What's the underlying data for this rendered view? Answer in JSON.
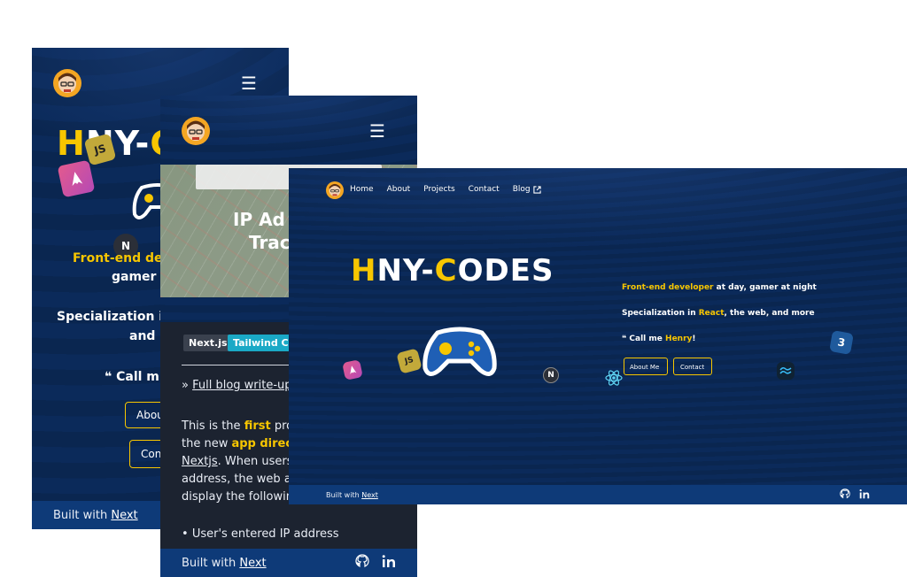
{
  "brand": {
    "name": "HNY-CODES",
    "first": "H",
    "mid": "NY-",
    "c": "C",
    "rest": "ODES"
  },
  "colors": {
    "accent": "#f7c600",
    "navy": "#0b2a5a",
    "footer": "#0e3a78"
  },
  "window1": {
    "menu_icon": "hamburger-icon",
    "hero_visible": "HNY-C",
    "hero_h": "H",
    "hero_ny": "NY-",
    "hero_c": "C",
    "line1_a": "Front-end dev",
    "line2": "gamer a",
    "line3": "Specialization in",
    "line4": "and r",
    "line5": "Call m",
    "about_btn": "Abou",
    "contact_btn": "Con",
    "footer_text": "Built with",
    "footer_link": "Next"
  },
  "window2": {
    "map_title_1": "IP Ad",
    "map_title_2": "Trac",
    "tags": [
      "Next.js",
      "Tailwind CSS"
    ],
    "blog_prefix": "» ",
    "blog_link": "Full blog write-up",
    "para_1": "This is the ",
    "para_first": "first",
    "para_2": " proje",
    "para_3": "the new ",
    "para_appdir": "app directo",
    "para_4": "Nextjs",
    "para_5": ". When users",
    "para_6": "address, the web ap",
    "para_7": "display the following",
    "bullet": "User's entered IP address",
    "footer_text": "Built with",
    "footer_link": "Next"
  },
  "window3": {
    "nav": [
      "Home",
      "About",
      "Projects",
      "Contact",
      "Blog"
    ],
    "hero_h": "H",
    "hero_ny": "NY-",
    "hero_c": "C",
    "hero_rest": "ODES",
    "line1_yellow": "Front-end developer",
    "line1_rest": " at day, gamer at night",
    "line2_a": "Specialization in ",
    "line2_yellow": "React",
    "line2_rest": ", the web, and more",
    "line3_a": "Call me ",
    "line3_yellow": "Henry",
    "line3_rest": "!",
    "about_btn": "About Me",
    "contact_btn": "Contact",
    "footer_text": "Built with",
    "footer_link": "Next"
  }
}
